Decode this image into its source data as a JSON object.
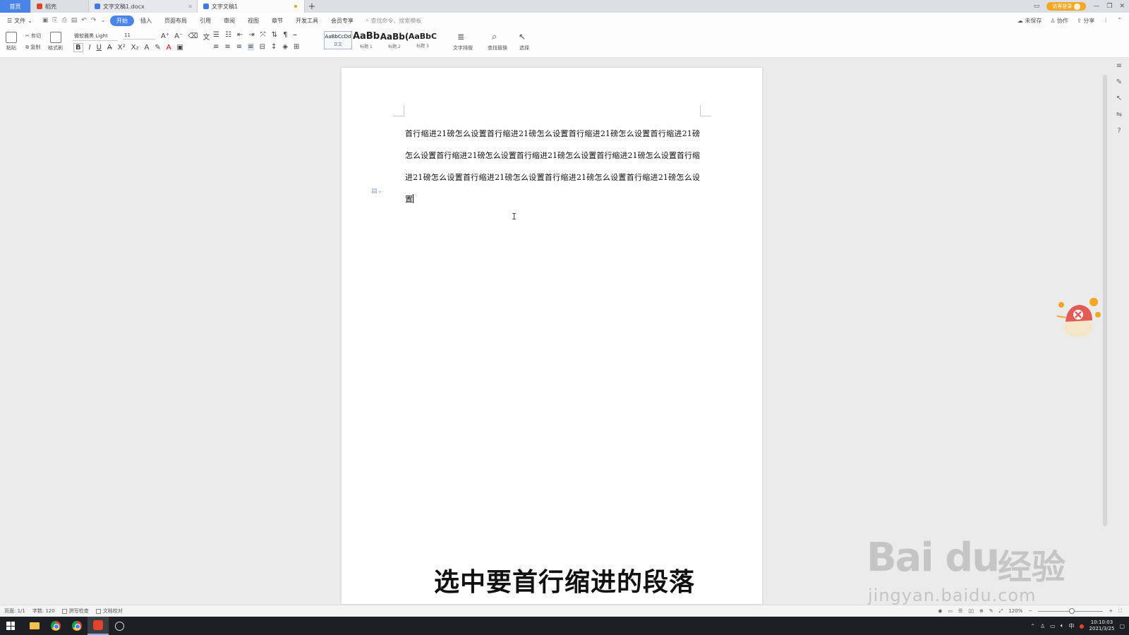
{
  "tabs": {
    "home": "首页",
    "straw": "稻壳",
    "doc1": "文字文稿1.docx",
    "doc2": "文字文稿1",
    "add": "+"
  },
  "titlebar": {
    "login": "访客登录",
    "min": "—",
    "restore": "❐",
    "close": "✕"
  },
  "menu": {
    "file": "文件",
    "items": [
      "开始",
      "插入",
      "页面布局",
      "引用",
      "审阅",
      "视图",
      "章节",
      "开发工具",
      "会员专享"
    ],
    "active_index": 0,
    "search_placeholder": "查找命令、搜索模板",
    "unsaved": "未保存",
    "collab": "协作",
    "share": "分享"
  },
  "ribbon": {
    "paste": "粘贴",
    "cut": "剪切",
    "copy": "复制",
    "format_painter": "格式刷",
    "font_name": "微软雅黑 Light",
    "font_size": "11",
    "styles": [
      {
        "sample": "AaBbCcDd",
        "label": "正文"
      },
      {
        "sample": "AaBb",
        "label": "标题 1"
      },
      {
        "sample": "AaBb(",
        "label": "标题 2"
      },
      {
        "sample": "AaBbC",
        "label": "标题 3"
      }
    ],
    "text_layout": "文字排版",
    "find_replace": "查找替换",
    "select": "选择"
  },
  "document": {
    "paragraph": "首行缩进21磅怎么设置首行缩进21磅怎么设置首行缩进21磅怎么设置首行缩进21磅怎么设置首行缩进21磅怎么设置首行缩进21磅怎么设置首行缩进21磅怎么设置首行缩进21磅怎么设置首行缩进21磅怎么设置首行缩进21磅怎么设置首行缩进21磅怎么设置"
  },
  "subtitle": "选中要首行缩进的段落",
  "watermark": {
    "logo": "Bai du",
    "cn": "经验",
    "url": "jingyan.baidu.com"
  },
  "statusbar": {
    "page": "页面: 1/1",
    "words": "字数: 120",
    "spell_check": "拼写检查",
    "doc_check": "文档校对",
    "zoom": "120%"
  },
  "taskbar": {
    "ime": "中",
    "time": "10:10:03",
    "date": "2021/3/25"
  },
  "colors": {
    "accent": "#4a84e8",
    "wps_red": "#e0442f",
    "login": "#f5a623"
  }
}
